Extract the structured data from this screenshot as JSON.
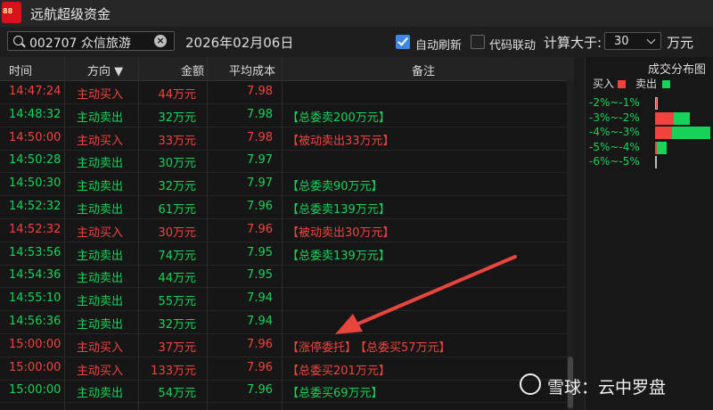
{
  "app": {
    "title": "远航超级资金",
    "icon_text": "88"
  },
  "toolbar": {
    "search_value": "002707 众信旅游",
    "date": "2026年02月06日",
    "auto_refresh": {
      "label": "自动刷新",
      "checked": true
    },
    "code_link": {
      "label": "代码联动",
      "checked": false
    },
    "calc_label": "计算大于:",
    "threshold": "30",
    "unit": "万元"
  },
  "table": {
    "headers": {
      "time": "时间",
      "direction": "方向 ▼",
      "amount": "金额",
      "avg_cost": "平均成本",
      "note": "备注"
    },
    "rows": [
      {
        "time": "14:47:24",
        "direction": "主动买入",
        "amount": "44万元",
        "avg": "7.98",
        "note": "",
        "note2": "",
        "side": "buy"
      },
      {
        "time": "14:48:32",
        "direction": "主动卖出",
        "amount": "32万元",
        "avg": "7.98",
        "note": "【总委卖200万元】",
        "note2": "",
        "side": "sell"
      },
      {
        "time": "14:50:00",
        "direction": "主动买入",
        "amount": "33万元",
        "avg": "7.98",
        "note": "【被动卖出33万元】",
        "note2": "",
        "side": "buy"
      },
      {
        "time": "14:50:28",
        "direction": "主动卖出",
        "amount": "30万元",
        "avg": "7.97",
        "note": "",
        "note2": "",
        "side": "sell"
      },
      {
        "time": "14:50:30",
        "direction": "主动卖出",
        "amount": "32万元",
        "avg": "7.97",
        "note": "【总委卖90万元】",
        "note2": "",
        "side": "sell"
      },
      {
        "time": "14:52:32",
        "direction": "主动卖出",
        "amount": "61万元",
        "avg": "7.96",
        "note": "【总委卖139万元】",
        "note2": "",
        "side": "sell"
      },
      {
        "time": "14:52:32",
        "direction": "主动买入",
        "amount": "30万元",
        "avg": "7.96",
        "note": "【被动卖出30万元】",
        "note2": "",
        "side": "buy"
      },
      {
        "time": "14:53:56",
        "direction": "主动卖出",
        "amount": "74万元",
        "avg": "7.95",
        "note": "【总委卖139万元】",
        "note2": "",
        "side": "sell"
      },
      {
        "time": "14:54:36",
        "direction": "主动卖出",
        "amount": "44万元",
        "avg": "7.95",
        "note": "",
        "note2": "",
        "side": "sell"
      },
      {
        "time": "14:55:10",
        "direction": "主动卖出",
        "amount": "55万元",
        "avg": "7.94",
        "note": "",
        "note2": "",
        "side": "sell"
      },
      {
        "time": "14:56:36",
        "direction": "主动卖出",
        "amount": "32万元",
        "avg": "7.94",
        "note": "",
        "note2": "",
        "side": "sell"
      },
      {
        "time": "15:00:00",
        "direction": "主动买入",
        "amount": "37万元",
        "avg": "7.96",
        "note": "【涨停委托】",
        "note2": "【总委买57万元】",
        "side": "buy"
      },
      {
        "time": "15:00:00",
        "direction": "主动买入",
        "amount": "133万元",
        "avg": "7.96",
        "note": "【总委买201万元】",
        "note2": "",
        "side": "buy"
      },
      {
        "time": "15:00:00",
        "direction": "主动卖出",
        "amount": "54万元",
        "avg": "7.96",
        "note": "【总委买69万元】",
        "note2": "",
        "side": "sell"
      }
    ]
  },
  "distribution": {
    "title": "成交分布图",
    "legend_buy": "买入",
    "legend_sell": "卖出",
    "buy_color": "#f2433f",
    "sell_color": "#17d35a",
    "rows": [
      {
        "label": "-2%~-1%",
        "buy": 0.05,
        "sell": 0.0,
        "outline": true
      },
      {
        "label": "-3%~-2%",
        "buy": 0.32,
        "sell": 0.28,
        "outline": false
      },
      {
        "label": "-4%~-3%",
        "buy": 0.29,
        "sell": 0.65,
        "outline": false
      },
      {
        "label": "-5%~-4%",
        "buy": 0.02,
        "sell": 0.17,
        "outline": false
      },
      {
        "label": "-6%~-5%",
        "buy": 0.03,
        "sell": 0.0,
        "outline": true
      }
    ]
  },
  "watermark": "雪球：云中罗盘"
}
